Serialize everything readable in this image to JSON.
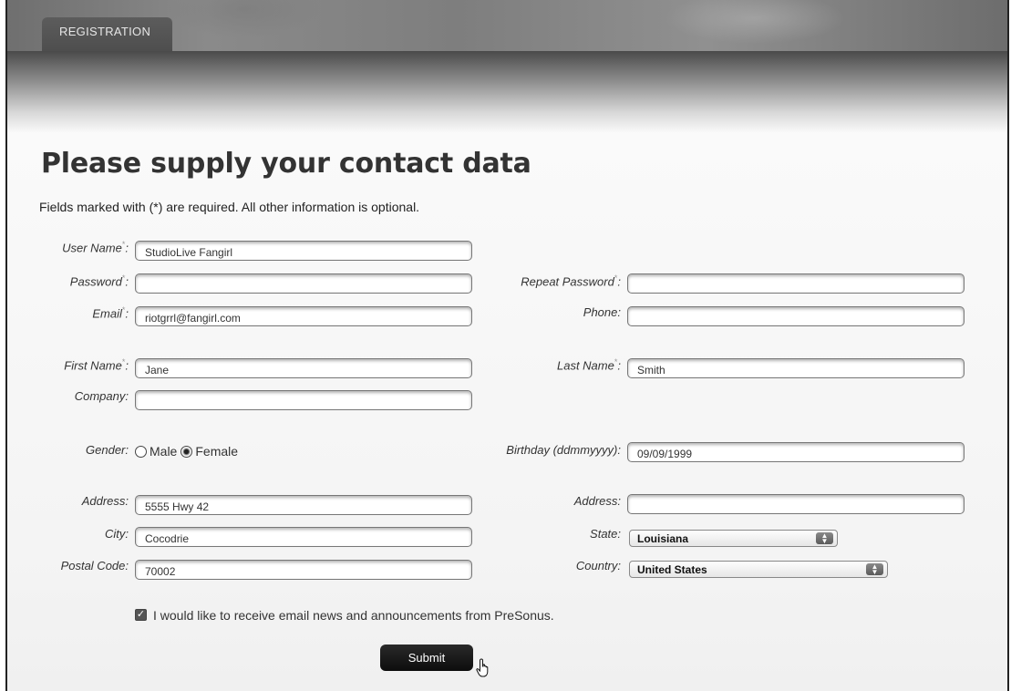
{
  "tab": {
    "label": "REGISTRATION"
  },
  "heading": "Please supply your contact data",
  "intro": "Fields marked with (*) are required. All other information is optional.",
  "required_marker": "*",
  "labels": {
    "user_name": "User Name",
    "password": "Password",
    "repeat_password": "Repeat Password",
    "email": "Email",
    "phone": "Phone",
    "first_name": "First Name",
    "last_name": "Last Name",
    "company": "Company",
    "gender": "Gender:",
    "birthday": "Birthday (ddmmyyyy):",
    "address": "Address:",
    "address2": "Address:",
    "city": "City:",
    "state": "State:",
    "postal_code": "Postal Code:",
    "country": "Country:"
  },
  "values": {
    "user_name": "StudioLive Fangirl",
    "password": "",
    "repeat_password": "",
    "email": "riotgrrl@fangirl.com",
    "phone": "",
    "first_name": "Jane",
    "last_name": "Smith",
    "company": "",
    "birthday": "09/09/1999",
    "address": "5555 Hwy 42",
    "address2": "",
    "city": "Cocodrie",
    "postal_code": "70002"
  },
  "gender": {
    "options": [
      "Male",
      "Female"
    ],
    "selected": "Female"
  },
  "state": {
    "selected": "Louisiana"
  },
  "country": {
    "selected": "United States"
  },
  "newsletter": {
    "label": "I would like to receive email news and announcements from PreSonus.",
    "checked": true
  },
  "submit": {
    "label": "Submit"
  }
}
